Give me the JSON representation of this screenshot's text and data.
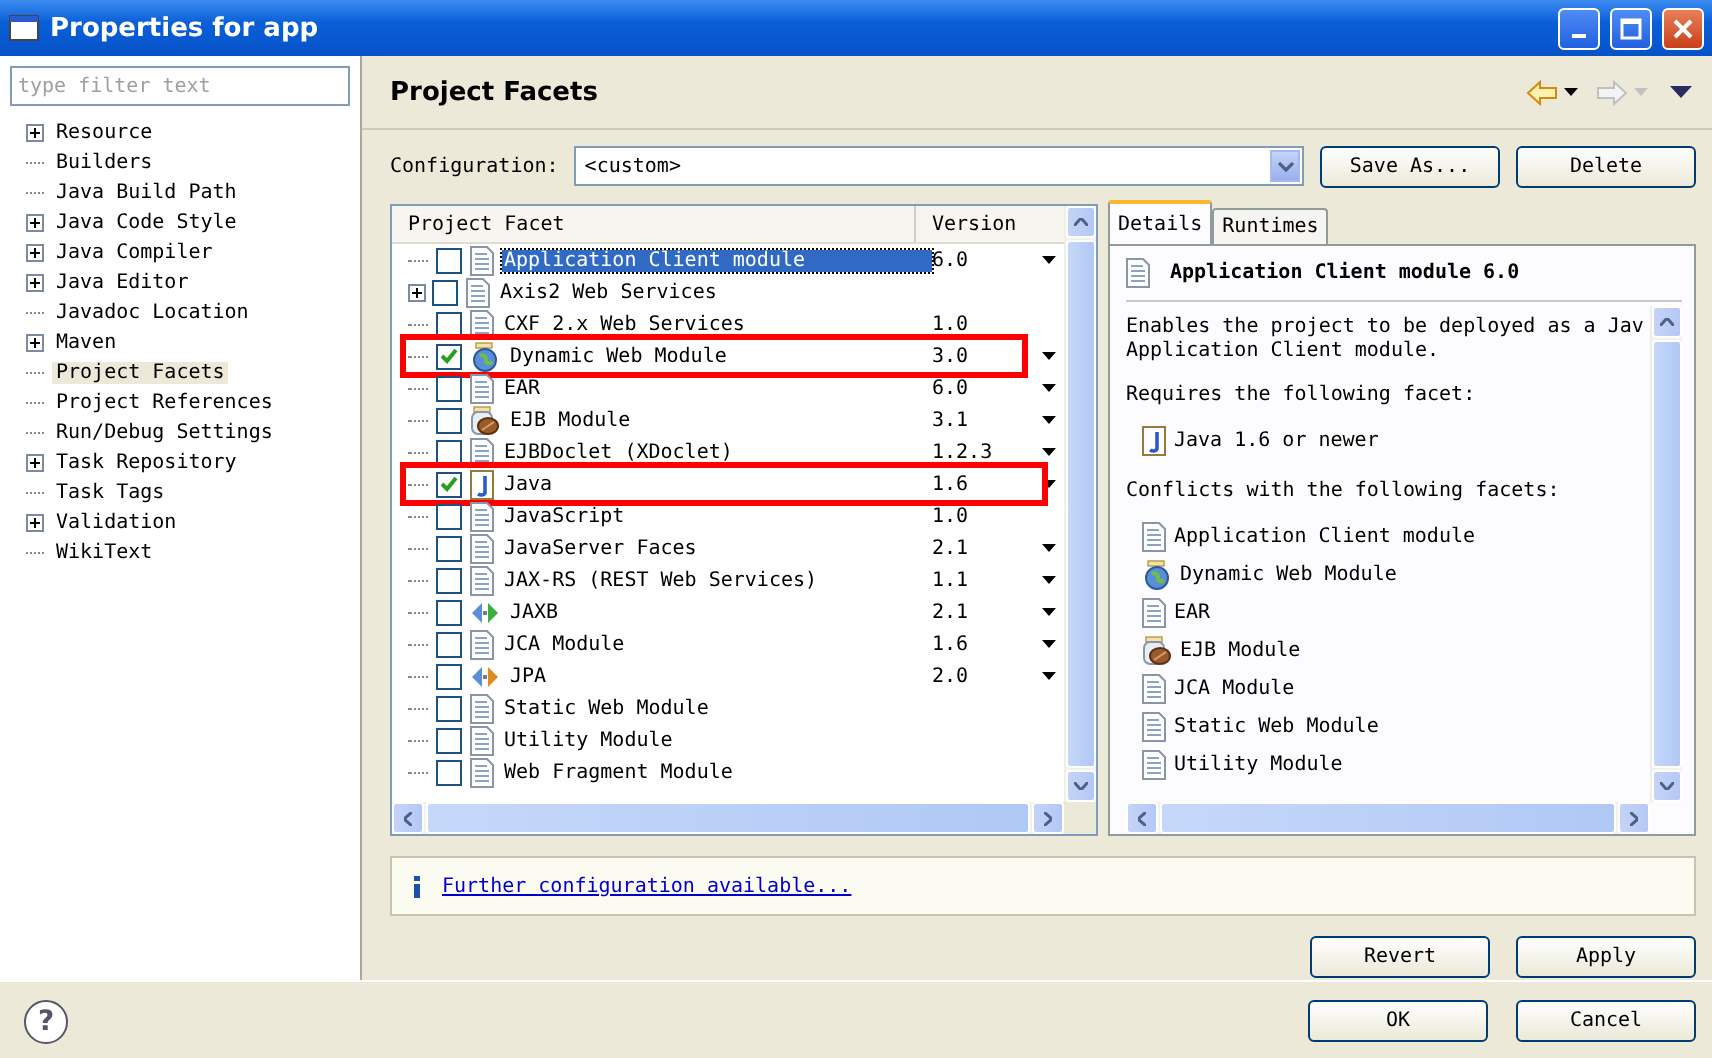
{
  "window": {
    "title": "Properties for app"
  },
  "sidebar": {
    "filter": {
      "placeholder": "type filter text"
    },
    "items": [
      {
        "label": "Resource",
        "expandable": true,
        "selected": false
      },
      {
        "label": "Builders",
        "expandable": false,
        "selected": false
      },
      {
        "label": "Java Build Path",
        "expandable": false,
        "selected": false
      },
      {
        "label": "Java Code Style",
        "expandable": true,
        "selected": false
      },
      {
        "label": "Java Compiler",
        "expandable": true,
        "selected": false
      },
      {
        "label": "Java Editor",
        "expandable": true,
        "selected": false
      },
      {
        "label": "Javadoc Location",
        "expandable": false,
        "selected": false
      },
      {
        "label": "Maven",
        "expandable": true,
        "selected": false
      },
      {
        "label": "Project Facets",
        "expandable": false,
        "selected": true
      },
      {
        "label": "Project References",
        "expandable": false,
        "selected": false
      },
      {
        "label": "Run/Debug Settings",
        "expandable": false,
        "selected": false
      },
      {
        "label": "Task Repository",
        "expandable": true,
        "selected": false
      },
      {
        "label": "Task Tags",
        "expandable": false,
        "selected": false
      },
      {
        "label": "Validation",
        "expandable": true,
        "selected": false
      },
      {
        "label": "WikiText",
        "expandable": false,
        "selected": false
      }
    ]
  },
  "page": {
    "title": "Project Facets",
    "configuration": {
      "label": "Configuration:",
      "value": "<custom>"
    },
    "buttons": [
      "Save As...",
      "Delete"
    ]
  },
  "facets": {
    "columns": [
      "Project Facet",
      "Version"
    ],
    "rows": [
      {
        "name": "Application Client module",
        "version": "6.0",
        "kind": "document",
        "checked": false,
        "selected": true,
        "expandable": false,
        "menu": true,
        "highlighted": false
      },
      {
        "name": "Axis2 Web Services",
        "kind": "document",
        "checked": false,
        "selected": false,
        "expandable": true,
        "menu": false,
        "highlighted": false
      },
      {
        "name": "CXF 2.x Web Services",
        "version": "1.0",
        "kind": "document",
        "checked": false,
        "selected": false,
        "expandable": false,
        "menu": false,
        "highlighted": false
      },
      {
        "name": "Dynamic Web Module",
        "version": "3.0",
        "kind": "web",
        "checked": true,
        "selected": false,
        "expandable": false,
        "menu": true,
        "highlighted": true
      },
      {
        "name": "EAR",
        "version": "6.0",
        "kind": "document",
        "checked": false,
        "selected": false,
        "expandable": false,
        "menu": true,
        "highlighted": false
      },
      {
        "name": "EJB Module",
        "version": "3.1",
        "kind": "bean",
        "checked": false,
        "selected": false,
        "expandable": false,
        "menu": true,
        "highlighted": false
      },
      {
        "name": "EJBDoclet (XDoclet)",
        "version": "1.2.3",
        "kind": "document",
        "checked": false,
        "selected": false,
        "expandable": false,
        "menu": true,
        "highlighted": false
      },
      {
        "name": "Java",
        "version": "1.6",
        "kind": "java",
        "checked": true,
        "selected": false,
        "expandable": false,
        "menu": true,
        "highlighted": true
      },
      {
        "name": "JavaScript",
        "version": "1.0",
        "kind": "document",
        "checked": false,
        "selected": false,
        "expandable": false,
        "menu": false,
        "highlighted": false
      },
      {
        "name": "JavaServer Faces",
        "version": "2.1",
        "kind": "document",
        "checked": false,
        "selected": false,
        "expandable": false,
        "menu": true,
        "highlighted": false
      },
      {
        "name": "JAX-RS (REST Web Services)",
        "version": "1.1",
        "kind": "document",
        "checked": false,
        "selected": false,
        "expandable": false,
        "menu": true,
        "highlighted": false
      },
      {
        "name": "JAXB",
        "version": "2.1",
        "kind": "binding",
        "checked": false,
        "selected": false,
        "expandable": false,
        "menu": true,
        "highlighted": false
      },
      {
        "name": "JCA Module",
        "version": "1.6",
        "kind": "document",
        "checked": false,
        "selected": false,
        "expandable": false,
        "menu": true,
        "highlighted": false
      },
      {
        "name": "JPA",
        "version": "2.0",
        "kind": "persistence",
        "checked": false,
        "selected": false,
        "expandable": false,
        "menu": true,
        "highlighted": false
      },
      {
        "name": "Static Web Module",
        "kind": "document",
        "checked": false,
        "selected": false,
        "expandable": false,
        "menu": false,
        "highlighted": false
      },
      {
        "name": "Utility Module",
        "kind": "document",
        "checked": false,
        "selected": false,
        "expandable": false,
        "menu": false,
        "highlighted": false
      },
      {
        "name": "Web Fragment Module",
        "kind": "document",
        "checked": false,
        "selected": false,
        "expandable": false,
        "menu": false,
        "highlighted": false
      }
    ]
  },
  "details": {
    "tabs": [
      {
        "label": "Details",
        "selected": true
      },
      {
        "label": "Runtimes",
        "selected": false
      }
    ],
    "title": "Application Client module 6.0",
    "kind": "document",
    "description": [
      "Enables the project to be deployed as a Jav",
      "Application Client module."
    ],
    "requires_heading": "Requires the following facet:",
    "requires": [
      {
        "name": "Java 1.6 or newer",
        "kind": "java"
      }
    ],
    "conflicts_heading": "Conflicts with the following facets:",
    "conflicts": [
      {
        "name": "Application Client module",
        "kind": "document"
      },
      {
        "name": "Dynamic Web Module",
        "kind": "web"
      },
      {
        "name": "EAR",
        "kind": "document"
      },
      {
        "name": "EJB Module",
        "kind": "bean"
      },
      {
        "name": "JCA Module",
        "kind": "document"
      },
      {
        "name": "Static Web Module",
        "kind": "document"
      },
      {
        "name": "Utility Module",
        "kind": "document"
      }
    ]
  },
  "info": {
    "link": "Further configuration available..."
  },
  "page_buttons": [
    "Revert",
    "Apply"
  ],
  "help": {
    "label": "?"
  },
  "dialog_buttons": [
    "OK",
    "Cancel"
  ]
}
